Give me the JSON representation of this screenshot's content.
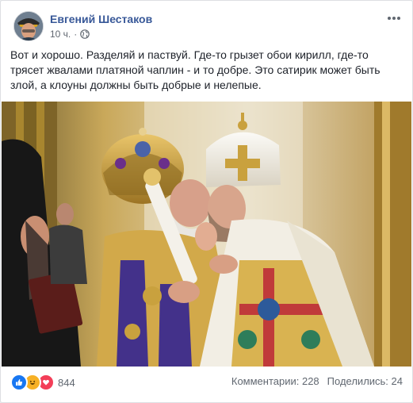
{
  "post": {
    "author": "Евгений Шестаков",
    "time": "10 ч.",
    "separator": "·",
    "privacy_icon": "globe-icon",
    "text": "Вот и хорошо. Разделяй и паствуй. Где-то грызет обои кирилл, где-то трясет жвалами платяной чаплин - и то добре. Это сатирик может быть злой, а клоуны должны быть добрые и нелепые."
  },
  "footer": {
    "reaction_icons": [
      "like-icon",
      "haha-icon",
      "love-icon"
    ],
    "reaction_count": "844",
    "comments_label": "Комментарии: 228",
    "shares_label": "Поделились: 24"
  },
  "colors": {
    "author": "#385898",
    "like": "#1877f2",
    "haha": "#f7b125",
    "love": "#f33e58"
  }
}
